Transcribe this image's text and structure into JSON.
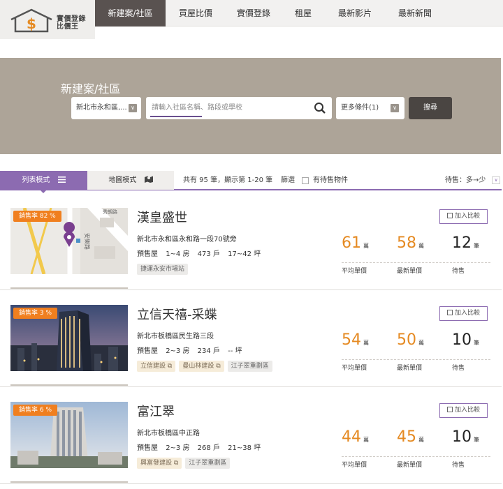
{
  "logo": {
    "line1": "實價登錄",
    "line2": "比價王",
    "symbol": "$"
  },
  "nav": [
    {
      "label": "新建案/社區",
      "active": true
    },
    {
      "label": "買屋比價",
      "active": false
    },
    {
      "label": "實價登錄",
      "active": false
    },
    {
      "label": "租屋",
      "active": false
    },
    {
      "label": "最新影片",
      "active": false
    },
    {
      "label": "最新新聞",
      "active": false
    }
  ],
  "search": {
    "title": "新建案/社區",
    "region_value": "新北市永和區,...",
    "placeholder": "請輸入社區名稱、路段或學校",
    "more_filters": "更多條件(1)",
    "submit_label": "搜尋"
  },
  "toolbar": {
    "list_mode": "列表模式",
    "map_mode": "地圖模式",
    "count_text": "共有 95 筆，顯示第 1-20 筆",
    "filter_label": "篩選",
    "checkbox_label": "有待售物件",
    "sort_label": "待售：多→少"
  },
  "listings": [
    {
      "badge": "銷售率 82 %",
      "name": "漢皇盛世",
      "address": "新北市永和區永和路一段70號旁",
      "status": "預售屋",
      "rooms": "1~4 房",
      "units": "473 戶",
      "size": "17~42 坪",
      "tags": [
        "捷運永安市場站"
      ],
      "map_label": "安樂路",
      "map_label2": "秀朗路",
      "compare_label": "加入比較",
      "avg_price": "61",
      "latest_price": "58",
      "for_sale": "12",
      "price_unit": "萬",
      "count_unit": "筆",
      "avg_label": "平均單價",
      "latest_label": "最新單價",
      "for_sale_label": "待售"
    },
    {
      "badge": "銷售率 3 %",
      "name": "立信天禧-采蝶",
      "address": "新北市板橋區民生路三段",
      "status": "預售屋",
      "rooms": "2~3 房",
      "units": "234 戶",
      "size": "-- 坪",
      "tags": [
        "立信建設",
        "曼山林建設",
        "江子翠重劃區"
      ],
      "compare_label": "加入比較",
      "avg_price": "54",
      "latest_price": "50",
      "for_sale": "10",
      "price_unit": "萬",
      "count_unit": "筆",
      "avg_label": "平均單價",
      "latest_label": "最新單價",
      "for_sale_label": "待售"
    },
    {
      "badge": "銷售率 6 %",
      "name": "富江翠",
      "address": "新北市板橋區中正路",
      "status": "預售屋",
      "rooms": "2~3 房",
      "units": "268 戶",
      "size": "21~38 坪",
      "tags": [
        "興富發建設",
        "江子翠重劃區"
      ],
      "compare_label": "加入比較",
      "avg_price": "44",
      "latest_price": "45",
      "for_sale": "10",
      "price_unit": "萬",
      "count_unit": "筆",
      "avg_label": "平均單價",
      "latest_label": "最新單價",
      "for_sale_label": "待售"
    }
  ],
  "colors": {
    "accent": "#8c6bb1",
    "orange": "#e58a22",
    "banner": "#ada498",
    "nav_active": "#595250"
  }
}
